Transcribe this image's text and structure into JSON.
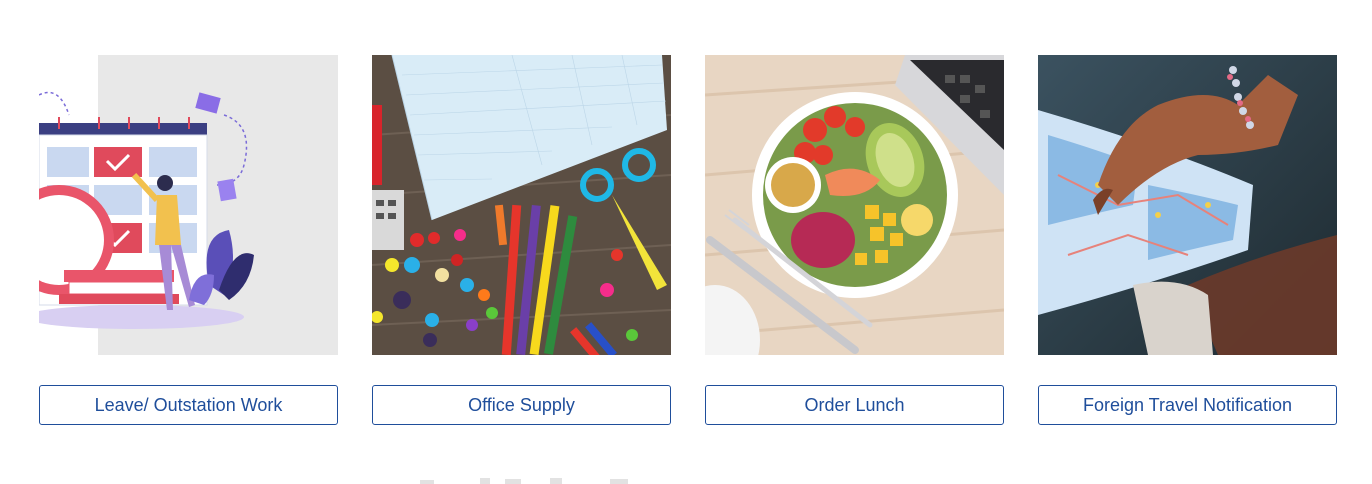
{
  "cards": [
    {
      "label": "Leave/ Outstation Work",
      "icon": "calendar-illustration"
    },
    {
      "label": "Office Supply",
      "icon": "stationery-photo"
    },
    {
      "label": "Order Lunch",
      "icon": "lunch-bowl-photo"
    },
    {
      "label": "Foreign Travel Notification",
      "icon": "travel-map-photo"
    }
  ],
  "colors": {
    "button_border": "#1f4e9b",
    "button_text": "#1f4e9b",
    "background": "#ffffff"
  }
}
